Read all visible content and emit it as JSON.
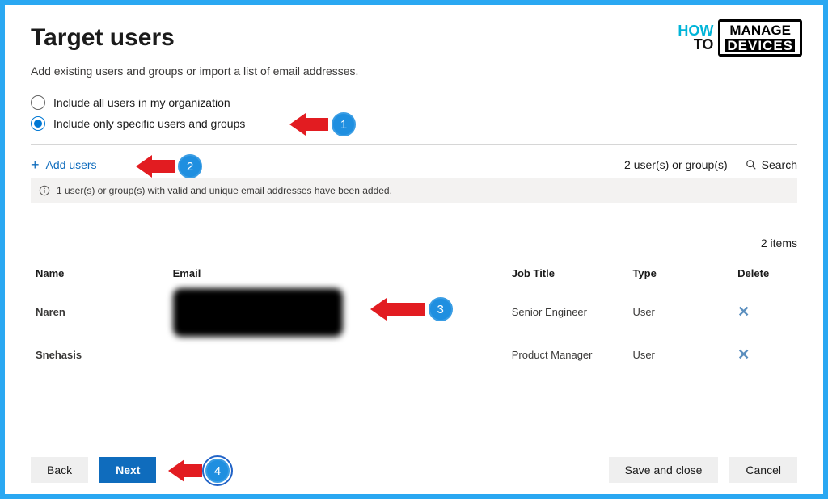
{
  "header": {
    "title": "Target users",
    "subtitle": "Add existing users and groups or import a list of email addresses."
  },
  "radios": {
    "all": "Include all users in my organization",
    "specific": "Include only specific users and groups"
  },
  "toolbar": {
    "add_users": "Add users",
    "count_label": "2 user(s) or group(s)",
    "search": "Search"
  },
  "info_bar": "1 user(s) or group(s) with valid and unique email addresses have been added.",
  "items_count": "2 items",
  "table": {
    "headers": {
      "name": "Name",
      "email": "Email",
      "job": "Job Title",
      "type": "Type",
      "delete": "Delete"
    },
    "rows": [
      {
        "name": "Naren",
        "email": "",
        "job": "Senior Engineer",
        "type": "User"
      },
      {
        "name": "Snehasis",
        "email": "",
        "job": "Product Manager",
        "type": "User"
      }
    ]
  },
  "footer": {
    "back": "Back",
    "next": "Next",
    "save_close": "Save and close",
    "cancel": "Cancel"
  },
  "callouts": {
    "1": "1",
    "2": "2",
    "3": "3",
    "4": "4"
  },
  "logo": {
    "how": "HOW",
    "to": "TO",
    "manage": "MANAGE",
    "devices": "DEVICES"
  }
}
